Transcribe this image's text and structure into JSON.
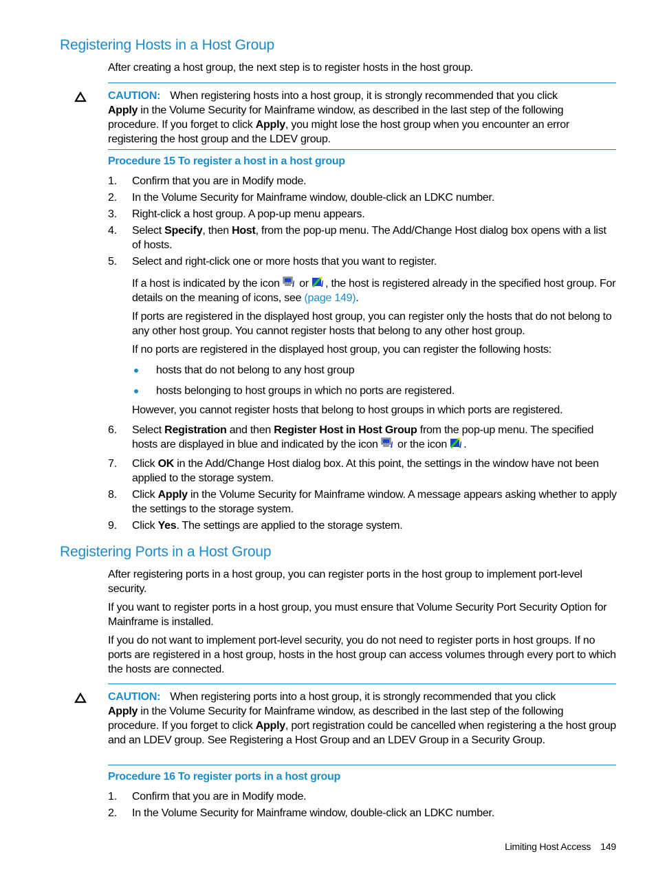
{
  "section1": {
    "heading": "Registering Hosts in a Host Group",
    "intro": "After creating a host group, the next step is to register hosts in the host group.",
    "caution": {
      "icon": "caution-triangle-icon",
      "label": "CAUTION:",
      "text_1": "When registering hosts into a host group, it is strongly recommended that you click",
      "bold_1": "Apply",
      "text_2": " in the Volume Security for Mainframe window, as described in the last step of the following procedure. If you forget to click ",
      "bold_2": "Apply",
      "text_3": ", you might lose the host group when you encounter an error registering the host group and the LDEV group."
    },
    "procedure_title": "Procedure 15 To register a host in a host group",
    "steps": [
      {
        "num": "1.",
        "text": "Confirm that you are in Modify mode."
      },
      {
        "num": "2.",
        "text": "In the Volume Security for Mainframe window, double-click an LDKC number."
      },
      {
        "num": "3.",
        "text": "Right-click a host group. A pop-up menu appears."
      },
      {
        "num": "4.",
        "t1": "Select ",
        "b1": "Specify",
        "t2": ", then ",
        "b2": "Host",
        "t3": ", from the pop-up menu. The Add/Change Host dialog box opens with a list of hosts."
      },
      {
        "num": "5.",
        "text": "Select and right-click one or more hosts that you want to register."
      },
      {
        "num": "6.",
        "t1": "Select ",
        "b1": "Registration",
        "t2": " and then ",
        "b2": "Register Host in Host Group",
        "t3": " from the pop-up menu. The specified hosts are displayed in blue and indicated by the icon ",
        "t4": " or the icon ",
        "t5": "."
      },
      {
        "num": "7.",
        "t1": "Click ",
        "b1": "OK",
        "t2": " in the Add/Change Host dialog box. At this point, the settings in the window have not been applied to the storage system."
      },
      {
        "num": "8.",
        "t1": "Click ",
        "b1": "Apply",
        "t2": " in the Volume Security for Mainframe window. A message appears asking whether to apply the settings to the storage system."
      },
      {
        "num": "9.",
        "t1": "Click ",
        "b1": "Yes",
        "t2": ". The settings are applied to the storage system."
      }
    ],
    "step5_notes": {
      "icon_note_1": "If a host is indicated by the icon ",
      "icon_note_2": " or ",
      "icon_note_3": ", the host is registered already in the specified host group. For details on the meaning of icons, see ",
      "icon_note_link": "(page 149)",
      "icon_note_4": ".",
      "ports_registered": "If ports are registered in the displayed host group, you can register only the hosts that do not belong to any other host group. You cannot register hosts that belong to any other host group.",
      "no_ports": "If no ports are registered in the displayed host group, you can register the following hosts:",
      "bullets": [
        "hosts that do not belong to any host group",
        "hosts belonging to host groups in which no ports are registered."
      ],
      "however": "However, you cannot register hosts that belong to host groups in which ports are registered."
    }
  },
  "section2": {
    "heading": "Registering Ports in a Host Group",
    "para1": "After registering ports in a host group, you can register ports in the host group to implement port-level security.",
    "para2": "If you want to register ports in a host group, you must ensure that Volume Security Port Security Option for Mainframe is installed.",
    "para3": "If you do not want to implement port-level security, you do not need to register ports in host groups. If no ports are registered in a host group, hosts in the host group can access volumes through every port to which the hosts are connected.",
    "caution": {
      "icon": "caution-triangle-icon",
      "label": "CAUTION:",
      "text_1": "When registering ports into a host group, it is strongly recommended that you click",
      "bold_1": "Apply",
      "text_2": " in the Volume Security for Mainframe window, as described in the last step of the following procedure. If you forget to click ",
      "bold_2": "Apply",
      "text_3": ", port registration could be cancelled when registering a the host group and an LDEV group. See Registering a Host Group and an LDEV Group in a Security Group."
    },
    "procedure_title": "Procedure 16 To register ports in a host group",
    "steps": [
      {
        "num": "1.",
        "text": "Confirm that you are in Modify mode."
      },
      {
        "num": "2.",
        "text": "In the Volume Security for Mainframe window, double-click an LDKC number."
      }
    ]
  },
  "footer": {
    "section_title": "Limiting Host Access",
    "page_number": "149"
  },
  "colors": {
    "accent": "#1a8ccc",
    "text": "#000000"
  }
}
